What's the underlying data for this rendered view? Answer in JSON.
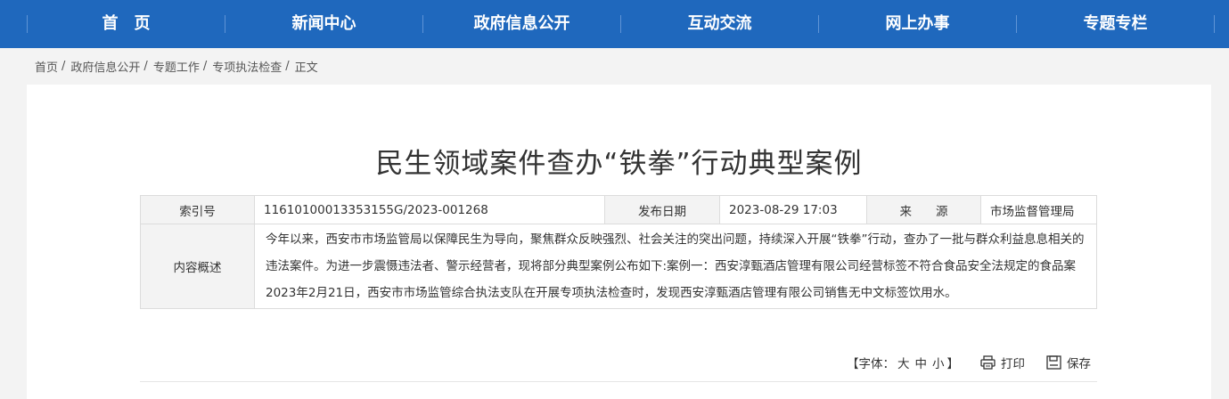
{
  "nav": {
    "items": [
      "首　页",
      "新闻中心",
      "政府信息公开",
      "互动交流",
      "网上办事",
      "专题专栏"
    ]
  },
  "breadcrumb": {
    "items": [
      "首页",
      "政府信息公开",
      "专题工作",
      "专项执法检查",
      "正文"
    ],
    "separator": "/"
  },
  "article": {
    "title": "民生领域案件查办“铁拳”行动典型案例"
  },
  "meta": {
    "index_label": "索引号",
    "index_value": "11610100013353155G/2023-001268",
    "date_label": "发布日期",
    "date_value": "2023-08-29 17:03",
    "source_label": "来　　源",
    "source_value": "市场监督管理局",
    "summary_label": "内容概述",
    "summary_value": "今年以来，西安市市场监管局以保障民生为导向，聚焦群众反映强烈、社会关注的突出问题，持续深入开展“铁拳”行动，查办了一批与群众利益息息相关的违法案件。为进一步震慑违法者、警示经营者，现将部分典型案例公布如下:案例一：西安淳甄酒店管理有限公司经营标签不符合食品安全法规定的食品案2023年2月21日，西安市市场监管综合执法支队在开展专项执法检查时，发现西安淳甄酒店管理有限公司销售无中文标签饮用水。"
  },
  "tools": {
    "font_prefix": "【字体：",
    "font_large": "大",
    "font_medium": "中",
    "font_small": "小",
    "font_suffix": "】",
    "print_label": "打印",
    "save_label": "保存",
    "print_icon": "printer-icon",
    "save_icon": "save-icon"
  },
  "colors": {
    "nav_bg": "#1f68bd",
    "page_bg": "#f3f3f3",
    "label_bg": "#f3f3f3"
  }
}
